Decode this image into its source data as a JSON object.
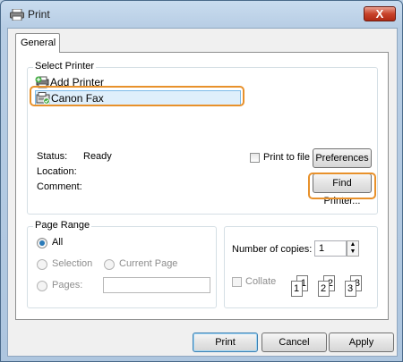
{
  "window": {
    "title": "Print",
    "close_label": "X",
    "icon": "printer-icon"
  },
  "tabs": [
    {
      "label": "General"
    }
  ],
  "select_printer": {
    "group_label": "Select Printer",
    "items": [
      {
        "label": "Add Printer",
        "icon": "add-printer-icon"
      },
      {
        "label": "Canon Fax",
        "icon": "fax-printer-icon",
        "selected": true
      }
    ],
    "status_label": "Status:",
    "status_value": "Ready",
    "location_label": "Location:",
    "comment_label": "Comment:",
    "print_to_file_label": "Print to file",
    "print_to_file_checked": false,
    "preferences_label": "Preferences",
    "find_printer_label": "Find Printer..."
  },
  "page_range": {
    "group_label": "Page Range",
    "all_label": "All",
    "selection_label": "Selection",
    "current_page_label": "Current Page",
    "pages_label": "Pages:",
    "pages_value": "",
    "selected": "all"
  },
  "copies": {
    "number_label": "Number of copies:",
    "number_value": "1",
    "collate_label": "Collate",
    "collate_checked": false,
    "collate_pages": [
      "1",
      "1",
      "2",
      "2",
      "3",
      "3"
    ]
  },
  "footer": {
    "print_label": "Print",
    "cancel_label": "Cancel",
    "apply_label": "Apply"
  },
  "colors": {
    "highlight": "#e8912b",
    "selection": "#dfeffb",
    "close_button": "#c8432b"
  }
}
